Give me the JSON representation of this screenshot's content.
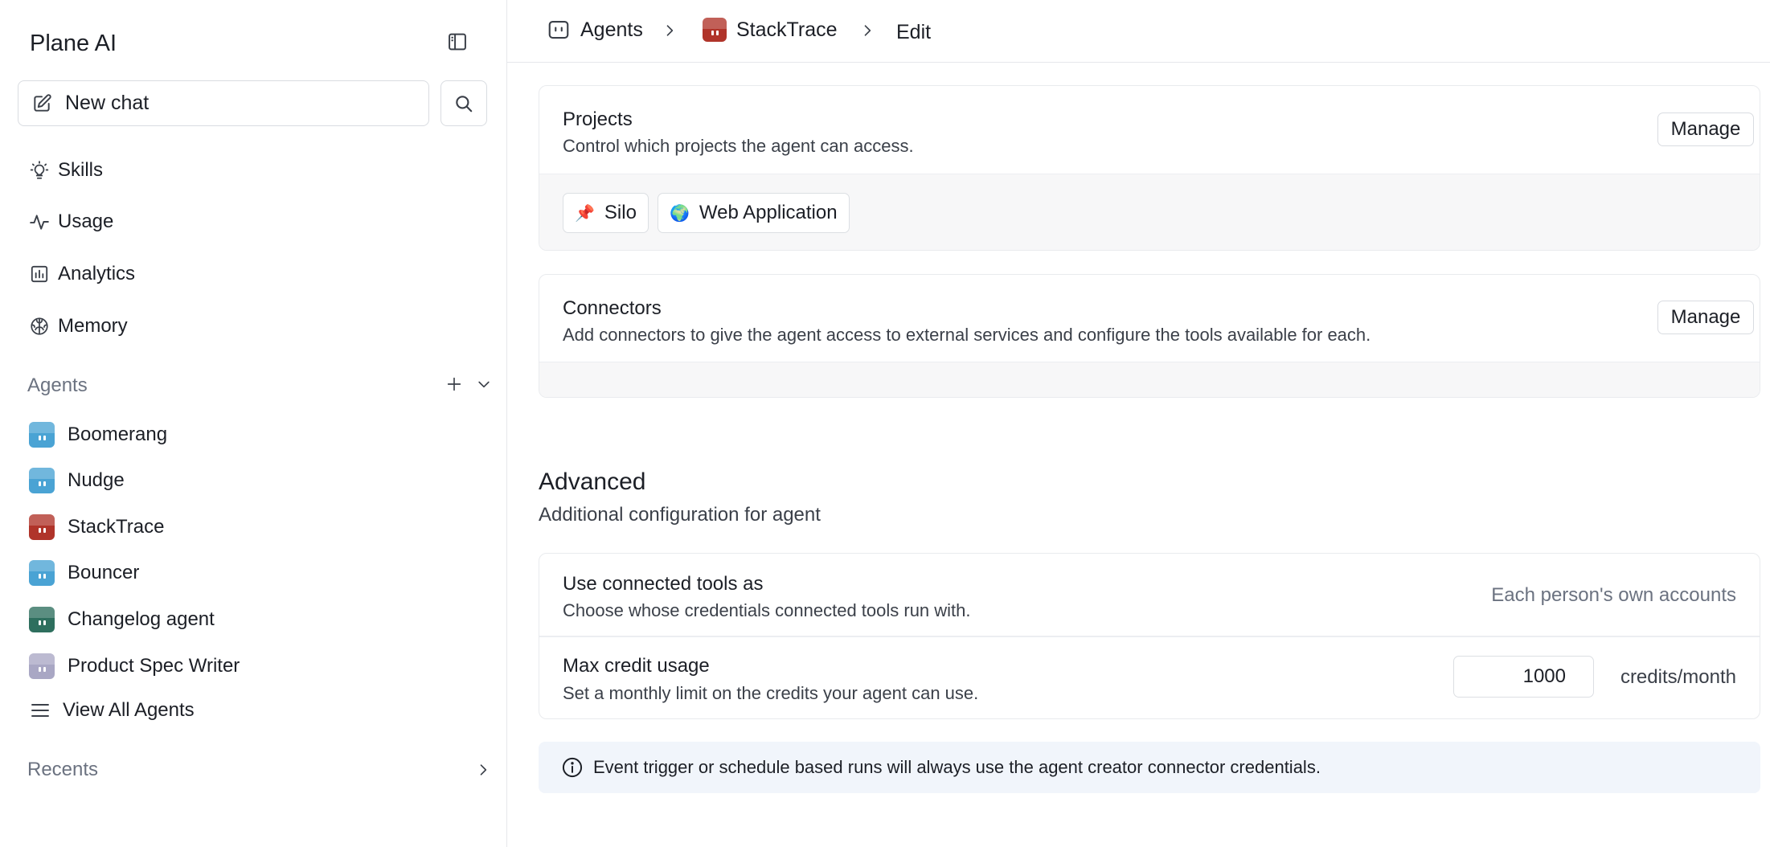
{
  "sidebar": {
    "app_title": "Plane AI",
    "new_chat_label": "New chat",
    "nav": [
      {
        "label": "Skills",
        "icon": "lightbulb-icon"
      },
      {
        "label": "Usage",
        "icon": "activity-icon"
      },
      {
        "label": "Analytics",
        "icon": "bar-chart-icon"
      },
      {
        "label": "Memory",
        "icon": "brain-icon"
      }
    ],
    "agents_header": "Agents",
    "agents": [
      {
        "label": "Boomerang",
        "color": "#4aa3d4"
      },
      {
        "label": "Nudge",
        "color": "#4aa3d4"
      },
      {
        "label": "StackTrace",
        "color": "#b0342a"
      },
      {
        "label": "Bouncer",
        "color": "#4aa3d4"
      },
      {
        "label": "Changelog agent",
        "color": "#2e6f5e"
      },
      {
        "label": "Product Spec Writer",
        "color": "#a9a7c4"
      }
    ],
    "view_all_label": "View All Agents",
    "recents_header": "Recents"
  },
  "breadcrumb": {
    "agents": "Agents",
    "agent": "StackTrace",
    "agent_color": "#b0342a",
    "current": "Edit"
  },
  "projects": {
    "title": "Projects",
    "description": "Control which projects the agent can access.",
    "manage_label": "Manage",
    "chips": [
      {
        "label": "Silo",
        "emoji": "📌"
      },
      {
        "label": "Web Application",
        "emoji": "🌍"
      }
    ]
  },
  "connectors": {
    "title": "Connectors",
    "description": "Add connectors to give the agent access to external services and configure the tools available for each.",
    "manage_label": "Manage"
  },
  "advanced": {
    "title": "Advanced",
    "subtitle": "Additional configuration for agent",
    "tools_title": "Use connected tools as",
    "tools_desc": "Choose whose credentials connected tools run with.",
    "tools_value": "Each person's own accounts",
    "credit_title": "Max credit usage",
    "credit_desc": "Set a monthly limit on the credits your agent can use.",
    "credit_value": "1000",
    "credit_unit": "credits/month"
  },
  "info": {
    "text": "Event trigger or schedule based runs will always use the agent creator connector credentials."
  },
  "colors": {
    "accent_border": "#e9ebee",
    "info_bg": "#f1f5fb"
  }
}
